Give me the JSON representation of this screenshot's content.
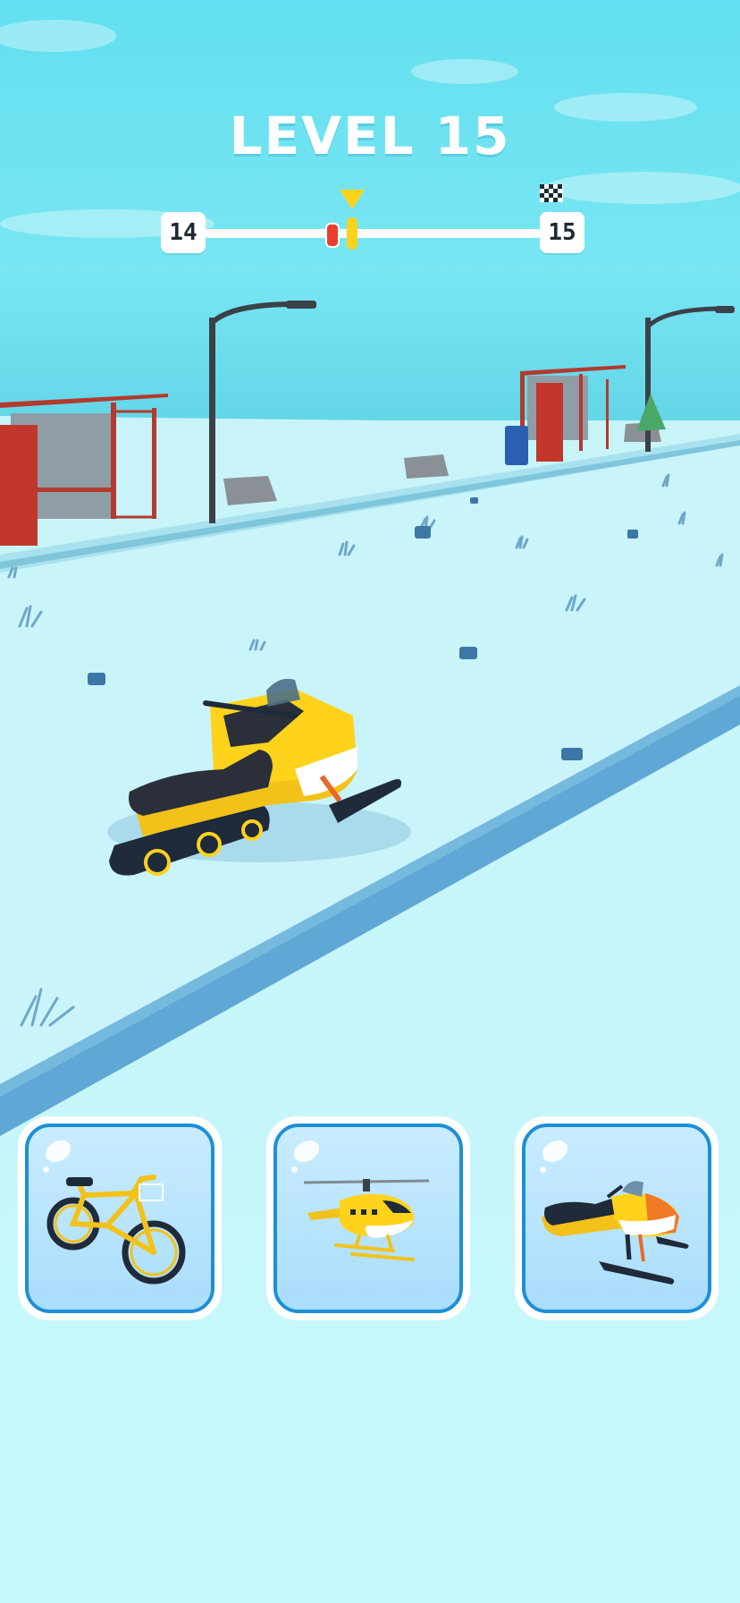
{
  "hud": {
    "title": "LEVEL 15",
    "current_level": "14",
    "next_level": "15",
    "progress_fraction": 0.44,
    "player_fraction": 0.38
  },
  "vehicles": [
    {
      "name": "bicycle",
      "icon": "bicycle-icon"
    },
    {
      "name": "helicopter",
      "icon": "helicopter-icon"
    },
    {
      "name": "snowmobile",
      "icon": "snowmobile-icon"
    }
  ],
  "colors": {
    "sky": "#5fdcec",
    "snow": "#c6f6fb",
    "accent_yellow": "#ffd21c",
    "card_border": "#1d8fd6",
    "player_red": "#e9402e"
  }
}
